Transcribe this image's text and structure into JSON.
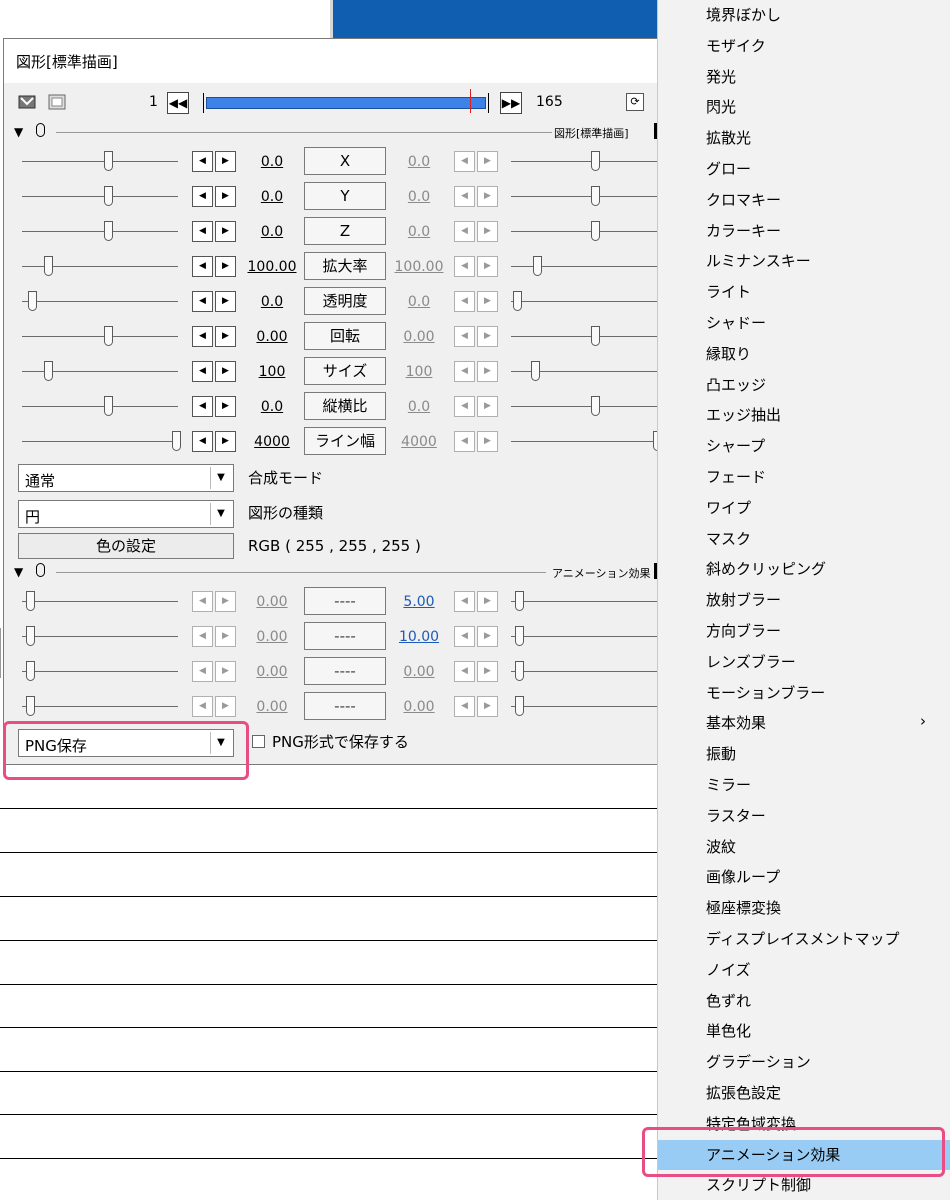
{
  "dialog": {
    "title": "図形[標準描画]",
    "frame_start": "1",
    "frame_end": "165",
    "section1_label": "図形[標準描画]",
    "section2_label": "アニメーション効果",
    "params": [
      {
        "left_value": "0.0",
        "name": "X",
        "right_value": "0.0"
      },
      {
        "left_value": "0.0",
        "name": "Y",
        "right_value": "0.0"
      },
      {
        "left_value": "0.0",
        "name": "Z",
        "right_value": "0.0"
      },
      {
        "left_value": "100.00",
        "name": "拡大率",
        "right_value": "100.00"
      },
      {
        "left_value": "0.0",
        "name": "透明度",
        "right_value": "0.0"
      },
      {
        "left_value": "0.00",
        "name": "回転",
        "right_value": "0.00"
      },
      {
        "left_value": "100",
        "name": "サイズ",
        "right_value": "100"
      },
      {
        "left_value": "0.0",
        "name": "縦横比",
        "right_value": "0.0"
      },
      {
        "left_value": "4000",
        "name": "ライン幅",
        "right_value": "4000"
      }
    ],
    "blend_mode": {
      "value": "通常",
      "label": "合成モード"
    },
    "shape_type": {
      "value": "円",
      "label": "図形の種類"
    },
    "color_button": "色の設定",
    "rgb_text": "RGB ( 255 , 255 , 255 )",
    "anim_params": [
      {
        "left_value": "0.00",
        "name": "----",
        "right_value": "5.00"
      },
      {
        "left_value": "0.00",
        "name": "----",
        "right_value": "10.00"
      },
      {
        "left_value": "0.00",
        "name": "----",
        "right_value": "0.00"
      },
      {
        "left_value": "0.00",
        "name": "----",
        "right_value": "0.00"
      }
    ],
    "anim_select": "PNG保存",
    "checkbox_label": "PNG形式で保存する"
  },
  "menu": {
    "items": [
      "境界ぼかし",
      "モザイク",
      "発光",
      "閃光",
      "拡散光",
      "グロー",
      "クロマキー",
      "カラーキー",
      "ルミナンスキー",
      "ライト",
      "シャドー",
      "縁取り",
      "凸エッジ",
      "エッジ抽出",
      "シャープ",
      "フェード",
      "ワイプ",
      "マスク",
      "斜めクリッピング",
      "放射ブラー",
      "方向ブラー",
      "レンズブラー",
      "モーションブラー",
      "基本効果",
      "振動",
      "ミラー",
      "ラスター",
      "波紋",
      "画像ループ",
      "極座標変換",
      "ディスプレイスメントマップ",
      "ノイズ",
      "色ずれ",
      "単色化",
      "グラデーション",
      "拡張色設定",
      "特定色域変換",
      "アニメーション効果",
      "スクリプト制御"
    ],
    "submenu_arrow": "›",
    "selected_item": "アニメーション効果"
  },
  "colors": {
    "highlight": "#e84e84",
    "menu_selected": "#99ccf4",
    "scrub_bar": "#3c82e8",
    "blue_background": "#0f5eb0"
  }
}
